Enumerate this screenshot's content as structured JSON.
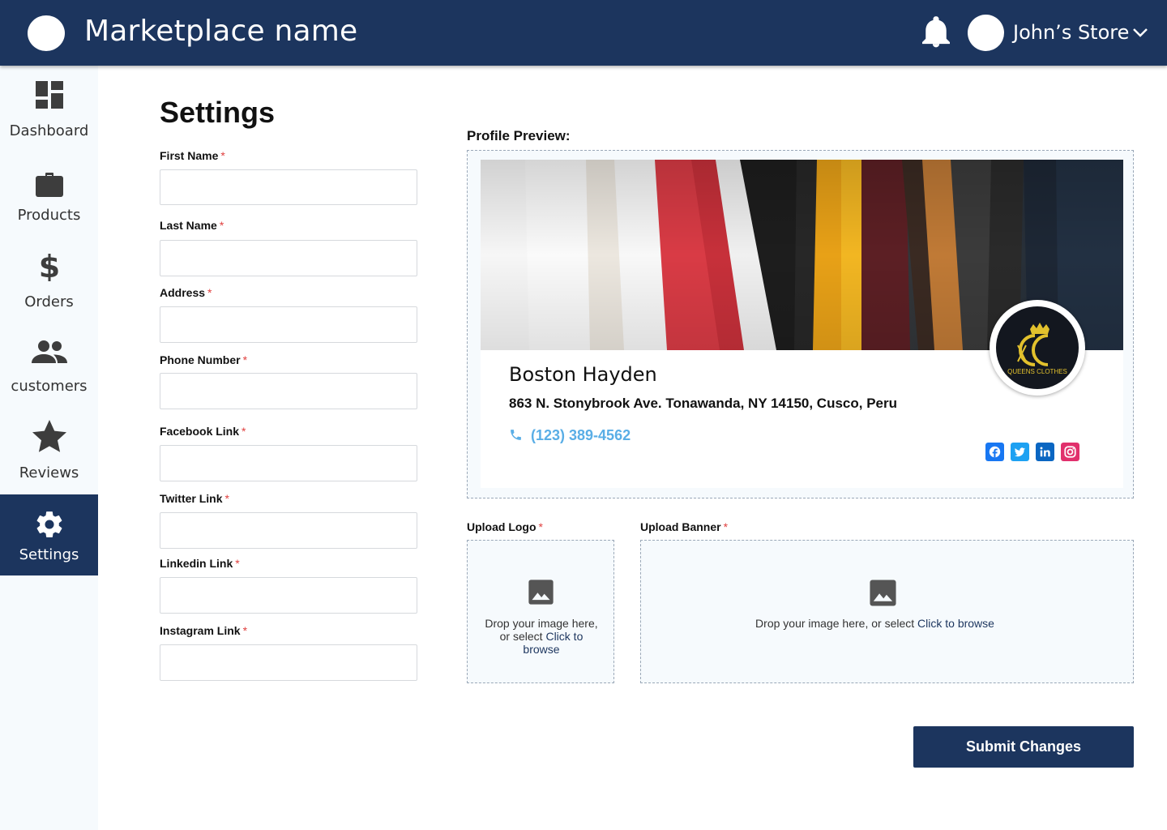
{
  "header": {
    "brand_name": "Marketplace name",
    "user_name": "John’s Store"
  },
  "sidebar": {
    "items": [
      {
        "label": "Dashboard",
        "icon": "dashboard-icon"
      },
      {
        "label": "Products",
        "icon": "briefcase-icon"
      },
      {
        "label": "Orders",
        "icon": "dollar-icon"
      },
      {
        "label": "customers",
        "icon": "people-icon"
      },
      {
        "label": "Reviews",
        "icon": "star-icon"
      },
      {
        "label": "Settings",
        "icon": "gear-icon",
        "active": true
      }
    ]
  },
  "page": {
    "title": "Settings"
  },
  "form": {
    "required_mark": "*",
    "first_name": {
      "label": "First Name",
      "value": ""
    },
    "last_name": {
      "label": "Last Name",
      "value": ""
    },
    "address": {
      "label": "Address",
      "value": ""
    },
    "phone": {
      "label": "Phone Number",
      "value": ""
    },
    "facebook": {
      "label": "Facebook Link",
      "value": ""
    },
    "twitter": {
      "label": "Twitter Link",
      "value": ""
    },
    "linkedin": {
      "label": "Linkedin Link",
      "value": ""
    },
    "instagram": {
      "label": "Instagram Link",
      "value": ""
    }
  },
  "preview": {
    "label": "Profile Preview:",
    "name": "Boston Hayden",
    "address": "863 N. Stonybrook Ave. Tonawanda, NY 14150,  Cusco, Peru",
    "phone": "(123) 389-4562",
    "logo_text": "QUEENS CLOTHES",
    "social": [
      "facebook-icon",
      "twitter-icon",
      "linkedin-icon",
      "instagram-icon"
    ],
    "colors": {
      "facebook": "#1877f2",
      "twitter": "#1da1f2",
      "linkedin": "#0a66c2",
      "instagram": "#e1306c"
    }
  },
  "upload": {
    "logo_label": "Upload Logo",
    "banner_label": "Upload Banner",
    "logo_text_1": "Drop your image here, or select ",
    "logo_link": "Click to browse",
    "banner_text": "Drop your image here, or select ",
    "banner_link": "Click to browse"
  },
  "actions": {
    "submit": "Submit Changes"
  },
  "theme": {
    "primary": "#1c355e",
    "required": "#e0403f",
    "phone": "#5aaee6"
  }
}
